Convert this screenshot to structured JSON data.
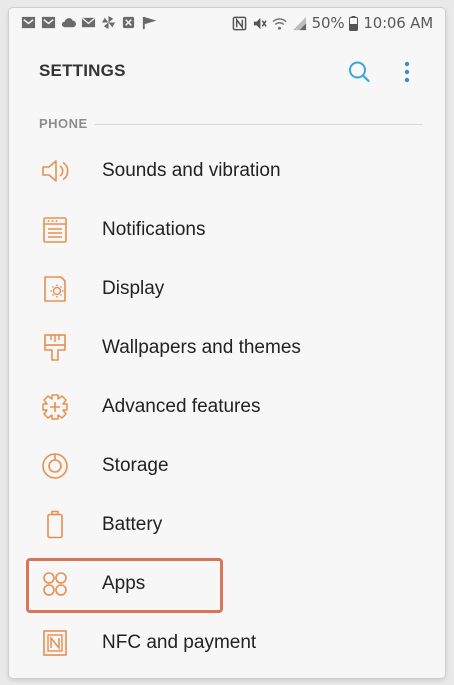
{
  "status_bar": {
    "battery": "50%",
    "time": "10:06 AM",
    "left_icons": [
      "gmail-icon",
      "gmail-icon",
      "cloud-icon",
      "email-icon",
      "pinwheel-icon",
      "box-icon",
      "flag-icon"
    ],
    "right_icons": [
      "nfc-icon",
      "mute-icon",
      "wifi-icon",
      "signal-icon",
      "battery-icon"
    ]
  },
  "header": {
    "title": "SETTINGS",
    "actions": [
      "search-icon",
      "more-vert-icon"
    ]
  },
  "section": {
    "label": "PHONE"
  },
  "items": [
    {
      "label": "Sounds and vibration",
      "icon": "speaker-icon"
    },
    {
      "label": "Notifications",
      "icon": "notifications-icon"
    },
    {
      "label": "Display",
      "icon": "display-icon"
    },
    {
      "label": "Wallpapers and themes",
      "icon": "paintbrush-icon"
    },
    {
      "label": "Advanced features",
      "icon": "advanced-features-icon"
    },
    {
      "label": "Storage",
      "icon": "storage-icon"
    },
    {
      "label": "Battery",
      "icon": "battery-outline-icon"
    },
    {
      "label": "Apps",
      "icon": "apps-icon"
    },
    {
      "label": "NFC and payment",
      "icon": "nfc-payment-icon"
    }
  ],
  "colors": {
    "icon_accent": "#e8904f",
    "highlight_border": "#d9765a",
    "search_icon": "#3aa7d6",
    "more_icon": "#3a8fc0"
  }
}
